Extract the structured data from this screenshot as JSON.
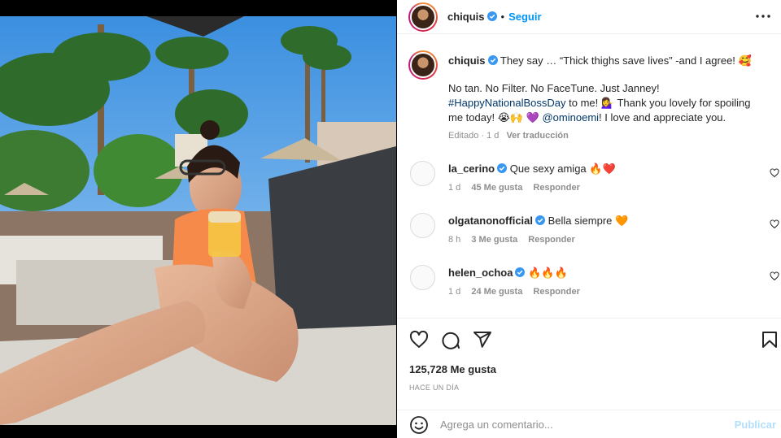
{
  "post": {
    "username": "chiquis",
    "follow_label": "Seguir",
    "dot": "•",
    "more_icon": "more-horizontal-icon"
  },
  "caption": {
    "username": "chiquis",
    "line1": "They say … “Thick thighs save lives” -and I agree! 🥰",
    "line2": "No tan. No Filter. No FaceTune. Just Janney!",
    "hashtag": "#HappyNationalBossDay",
    "line3_rest": " to me! 💁‍♀️ Thank you lovely for spoiling",
    "line4_start": "me today! 😭🙌 💜 ",
    "mention": "@ominoemi",
    "line4_end": "! I love and appreciate you.",
    "meta_edited": "Editado · 1 d",
    "meta_translate": "Ver traducción"
  },
  "comments": [
    {
      "username": "la_cerino",
      "text": "Que sexy amiga 🔥❤️",
      "age": "1 d",
      "likes": "45 Me gusta",
      "reply": "Responder"
    },
    {
      "username": "olgatanonofficial",
      "text": "Bella siempre 🧡",
      "age": "8 h",
      "likes": "3 Me gusta",
      "reply": "Responder"
    },
    {
      "username": "helen_ochoa",
      "text": "🔥🔥🔥",
      "age": "1 d",
      "likes": "24 Me gusta",
      "reply": "Responder"
    }
  ],
  "actions": {
    "like_icon": "heart-icon",
    "comment_icon": "comment-icon",
    "share_icon": "share-icon",
    "save_icon": "bookmark-icon",
    "likes_count": "125,728 Me gusta",
    "time_ago": "HACE UN DÍA"
  },
  "add_comment": {
    "placeholder": "Agrega un comentario...",
    "publish_label": "Publicar",
    "emoji_icon": "emoji-icon"
  },
  "colors": {
    "accent": "#0095f6",
    "publish_disabled": "#b2dffc",
    "verified": "#3897f0",
    "muted": "#8e8e8e"
  }
}
